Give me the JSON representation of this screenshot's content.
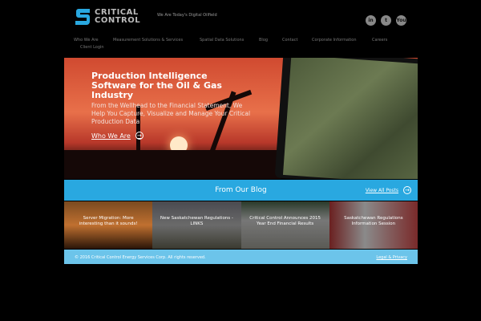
{
  "header": {
    "logo_text_line1": "CRITICAL",
    "logo_text_line2": "CONTROL",
    "tagline": "We Are Today's Digital Oilfield",
    "social": [
      {
        "icon": "linkedin-icon",
        "label": "in"
      },
      {
        "icon": "twitter-icon",
        "label": "t"
      },
      {
        "icon": "youtube-icon",
        "label": "You"
      }
    ]
  },
  "nav": [
    "Who We Are",
    "Measurement Solutions & Services",
    "Spatial Data Solutions",
    "Blog",
    "Contact",
    "Corporate Information",
    "Careers",
    "Client Login"
  ],
  "hero": {
    "title": "Production Intelligence Software for the Oil & Gas Industry",
    "subtitle": "From the Wellhead to the Financial Statement, We Help You Capture, Visualize and Manage Your Critical Production Data",
    "link": "Who We Are"
  },
  "blog": {
    "title": "From Our Blog",
    "view_all": "View All Posts",
    "posts": [
      "Server Migration: More interesting than it sounds!",
      "New Saskatchewan Regulations - LINKS",
      "Critical Control Announces 2015 Year End Financial Results",
      "Saskatchewan Regulations Information Session"
    ]
  },
  "footer": {
    "copyright": "© 2016 Critical Control Energy Services Corp. All rights reserved.",
    "legal": "Legal & Privacy"
  },
  "colors": {
    "brand_blue": "#29a8e0",
    "footer_blue": "#6cc4ea"
  }
}
